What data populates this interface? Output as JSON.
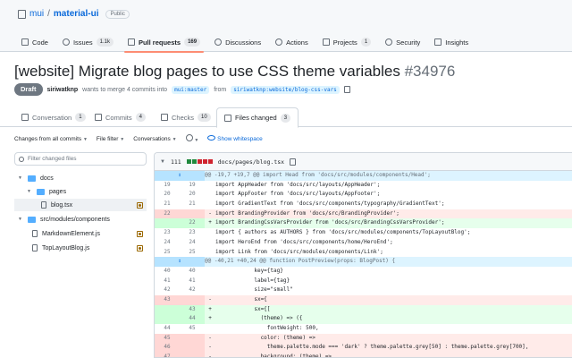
{
  "repo": {
    "owner": "mui",
    "separator": "/",
    "name": "material-ui",
    "visibility": "Public"
  },
  "nav": [
    {
      "label": "Code",
      "icon": "code-icon",
      "count": ""
    },
    {
      "label": "Issues",
      "icon": "issue-icon",
      "count": "1.1k"
    },
    {
      "label": "Pull requests",
      "icon": "pull-request-icon",
      "count": "169",
      "active": true
    },
    {
      "label": "Discussions",
      "icon": "discussion-icon",
      "count": ""
    },
    {
      "label": "Actions",
      "icon": "play-icon",
      "count": ""
    },
    {
      "label": "Projects",
      "icon": "table-icon",
      "count": "1"
    },
    {
      "label": "Security",
      "icon": "shield-icon",
      "count": ""
    },
    {
      "label": "Insights",
      "icon": "graph-icon",
      "count": ""
    }
  ],
  "pr": {
    "title": "[website] Migrate blog pages to use CSS theme variables",
    "number": "#34976",
    "status": "Draft",
    "author": "siriwatknp",
    "meta_text": "wants to merge 4 commits into",
    "base_branch": "mui:master",
    "from_text": "from",
    "head_branch": "siriwatknp:website/blog-css-vars"
  },
  "tabs": [
    {
      "label": "Conversation",
      "count": "1",
      "icon": "comment-icon"
    },
    {
      "label": "Commits",
      "count": "4",
      "icon": "commit-icon"
    },
    {
      "label": "Checks",
      "count": "10",
      "icon": "checklist-icon"
    },
    {
      "label": "Files changed",
      "count": "3",
      "icon": "file-diff-icon",
      "active": true
    }
  ],
  "toolbar": {
    "changes_from": "Changes from all commits",
    "file_filter": "File filter",
    "conversations": "Conversations",
    "show_whitespace": "Show whitespace"
  },
  "sidebar": {
    "filter_placeholder": "Filter changed files",
    "tree": [
      {
        "label": "docs",
        "type": "folder",
        "depth": 0
      },
      {
        "label": "pages",
        "type": "folder",
        "depth": 1
      },
      {
        "label": "blog.tsx",
        "type": "file",
        "depth": 2,
        "selected": true
      },
      {
        "label": "src/modules/components",
        "type": "folder",
        "depth": 0
      },
      {
        "label": "MarkdownElement.js",
        "type": "file",
        "depth": 1
      },
      {
        "label": "TopLayoutBlog.js",
        "type": "file",
        "depth": 1
      }
    ]
  },
  "diff": {
    "changes": "111",
    "path": "docs/pages/blog.tsx",
    "lines": [
      {
        "type": "hunk",
        "old": "",
        "new": "",
        "marker": "",
        "code": "@@ -19,7 +19,7 @@ import Head from 'docs/src/modules/components/Head';"
      },
      {
        "type": "ctx",
        "old": "19",
        "new": "19",
        "marker": "",
        "code": "import AppHeader from 'docs/src/layouts/AppHeader';"
      },
      {
        "type": "ctx",
        "old": "20",
        "new": "20",
        "marker": "",
        "code": "import AppFooter from 'docs/src/layouts/AppFooter';"
      },
      {
        "type": "ctx",
        "old": "21",
        "new": "21",
        "marker": "",
        "code": "import GradientText from 'docs/src/components/typography/GradientText';"
      },
      {
        "type": "del",
        "old": "22",
        "new": "",
        "marker": "-",
        "code": "import BrandingProvider from 'docs/src/BrandingProvider';"
      },
      {
        "type": "add",
        "old": "",
        "new": "22",
        "marker": "+",
        "code": "import BrandingCssVarsProvider from 'docs/src/BrandingCssVarsProvider';"
      },
      {
        "type": "ctx",
        "old": "23",
        "new": "23",
        "marker": "",
        "code": "import { authors as AUTHORS } from 'docs/src/modules/components/TopLayoutBlog';"
      },
      {
        "type": "ctx",
        "old": "24",
        "new": "24",
        "marker": "",
        "code": "import HeroEnd from 'docs/src/components/home/HeroEnd';"
      },
      {
        "type": "ctx",
        "old": "25",
        "new": "25",
        "marker": "",
        "code": "import Link from 'docs/src/modules/components/Link';"
      },
      {
        "type": "hunk",
        "old": "",
        "new": "",
        "marker": "",
        "code": "@@ -40,21 +40,24 @@ function PostPreview(props: BlogPost) {"
      },
      {
        "type": "ctx",
        "old": "40",
        "new": "40",
        "marker": "",
        "code": "            key={tag}"
      },
      {
        "type": "ctx",
        "old": "41",
        "new": "41",
        "marker": "",
        "code": "            label={tag}"
      },
      {
        "type": "ctx",
        "old": "42",
        "new": "42",
        "marker": "",
        "code": "            size=\"small\""
      },
      {
        "type": "del",
        "old": "43",
        "new": "",
        "marker": "-",
        "code": "            sx={"
      },
      {
        "type": "add",
        "old": "",
        "new": "43",
        "marker": "+",
        "code": "            sx={["
      },
      {
        "type": "add",
        "old": "",
        "new": "44",
        "marker": "+",
        "code": "              (theme) => ({"
      },
      {
        "type": "ctx",
        "old": "44",
        "new": "45",
        "marker": "",
        "code": "                fontWeight: 500,"
      },
      {
        "type": "del",
        "old": "45",
        "new": "",
        "marker": "-",
        "code": "              color: (theme) =>"
      },
      {
        "type": "del",
        "old": "46",
        "new": "",
        "marker": "-",
        "code": "                theme.palette.mode === 'dark' ? theme.palette.grey[50] : theme.palette.grey[700],"
      },
      {
        "type": "del",
        "old": "47",
        "new": "",
        "marker": "-",
        "code": "              background: (theme) =>"
      }
    ]
  },
  "colors": {
    "accent": "#0969da",
    "tab_underline": "#fd8c73",
    "add_bg": "#e6ffec",
    "del_bg": "#ffebe9",
    "hunk_bg": "#ddf4ff",
    "draft": "#6e7781"
  }
}
